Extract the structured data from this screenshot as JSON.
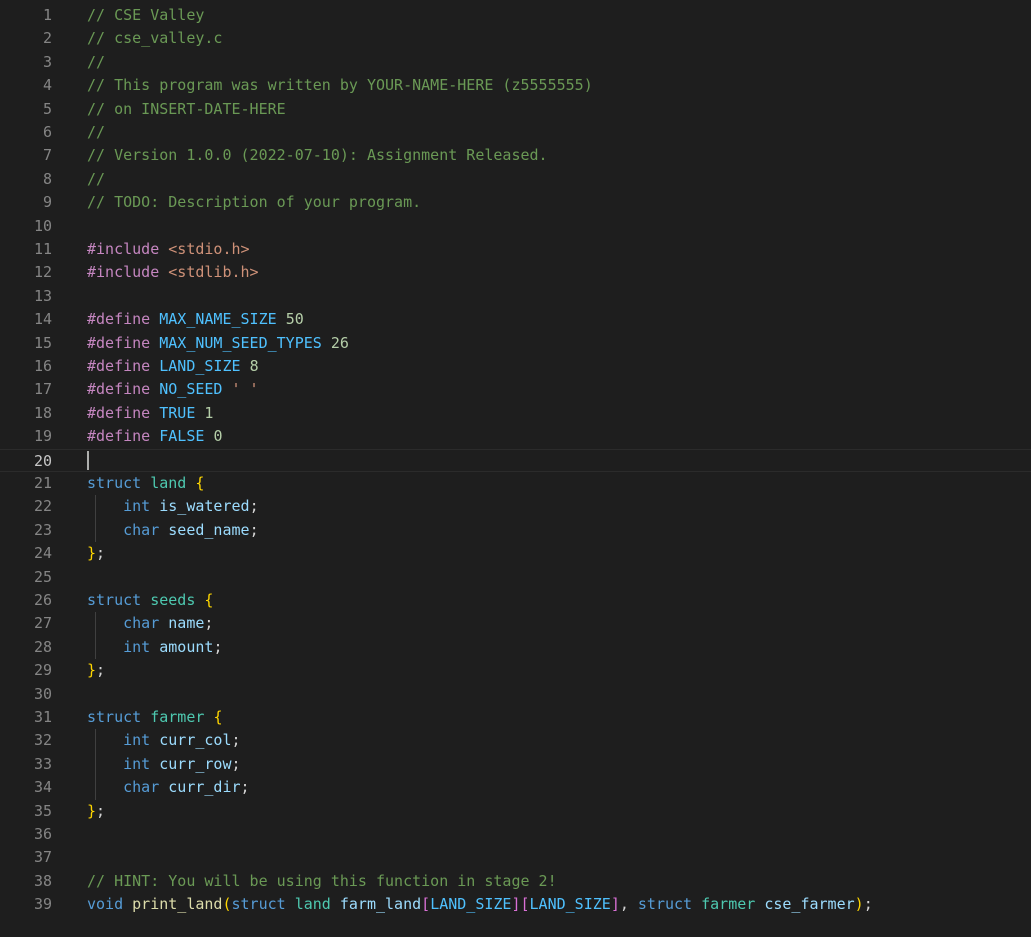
{
  "editor": {
    "language": "c",
    "current_line": 20,
    "colors": {
      "background": "#1e1e1e",
      "comment": "#6a9955",
      "keyword": "#569cd6",
      "macro": "#c586c0",
      "constant": "#4fc1ff",
      "number": "#b5cea8",
      "string": "#ce9178",
      "type": "#4ec9b0",
      "variable": "#9cdcfe",
      "bracket": "#ffd700"
    },
    "lines": [
      {
        "n": "1",
        "tokens": [
          {
            "c": "comment",
            "t": "// CSE Valley"
          }
        ]
      },
      {
        "n": "2",
        "tokens": [
          {
            "c": "comment",
            "t": "// cse_valley.c"
          }
        ]
      },
      {
        "n": "3",
        "tokens": [
          {
            "c": "comment",
            "t": "//"
          }
        ]
      },
      {
        "n": "4",
        "tokens": [
          {
            "c": "comment",
            "t": "// This program was written by YOUR-NAME-HERE (z5555555)"
          }
        ]
      },
      {
        "n": "5",
        "tokens": [
          {
            "c": "comment",
            "t": "// on INSERT-DATE-HERE"
          }
        ]
      },
      {
        "n": "6",
        "tokens": [
          {
            "c": "comment",
            "t": "//"
          }
        ]
      },
      {
        "n": "7",
        "tokens": [
          {
            "c": "comment",
            "t": "// Version 1.0.0 (2022-07-10): Assignment Released."
          }
        ]
      },
      {
        "n": "8",
        "tokens": [
          {
            "c": "comment",
            "t": "//"
          }
        ]
      },
      {
        "n": "9",
        "tokens": [
          {
            "c": "comment",
            "t": "// TODO: Description of your program."
          }
        ]
      },
      {
        "n": "10",
        "tokens": []
      },
      {
        "n": "11",
        "tokens": [
          {
            "c": "macro",
            "t": "#include "
          },
          {
            "c": "include-str",
            "t": "<stdio.h>"
          }
        ]
      },
      {
        "n": "12",
        "tokens": [
          {
            "c": "macro",
            "t": "#include "
          },
          {
            "c": "include-str",
            "t": "<stdlib.h>"
          }
        ]
      },
      {
        "n": "13",
        "tokens": []
      },
      {
        "n": "14",
        "tokens": [
          {
            "c": "macro",
            "t": "#define "
          },
          {
            "c": "ident",
            "t": "MAX_NAME_SIZE"
          },
          {
            "c": "text",
            "t": " "
          },
          {
            "c": "num",
            "t": "50"
          }
        ]
      },
      {
        "n": "15",
        "tokens": [
          {
            "c": "macro",
            "t": "#define "
          },
          {
            "c": "ident",
            "t": "MAX_NUM_SEED_TYPES"
          },
          {
            "c": "text",
            "t": " "
          },
          {
            "c": "num",
            "t": "26"
          }
        ]
      },
      {
        "n": "16",
        "tokens": [
          {
            "c": "macro",
            "t": "#define "
          },
          {
            "c": "ident",
            "t": "LAND_SIZE"
          },
          {
            "c": "text",
            "t": " "
          },
          {
            "c": "num",
            "t": "8"
          }
        ]
      },
      {
        "n": "17",
        "tokens": [
          {
            "c": "macro",
            "t": "#define "
          },
          {
            "c": "ident",
            "t": "NO_SEED"
          },
          {
            "c": "text",
            "t": " "
          },
          {
            "c": "str",
            "t": "' '"
          }
        ]
      },
      {
        "n": "18",
        "tokens": [
          {
            "c": "macro",
            "t": "#define "
          },
          {
            "c": "ident",
            "t": "TRUE"
          },
          {
            "c": "text",
            "t": " "
          },
          {
            "c": "num",
            "t": "1"
          }
        ]
      },
      {
        "n": "19",
        "tokens": [
          {
            "c": "macro",
            "t": "#define "
          },
          {
            "c": "ident",
            "t": "FALSE"
          },
          {
            "c": "text",
            "t": " "
          },
          {
            "c": "num",
            "t": "0"
          }
        ]
      },
      {
        "n": "20",
        "tokens": []
      },
      {
        "n": "21",
        "tokens": [
          {
            "c": "kw",
            "t": "struct"
          },
          {
            "c": "text",
            "t": " "
          },
          {
            "c": "type",
            "t": "land"
          },
          {
            "c": "text",
            "t": " "
          },
          {
            "c": "brace",
            "t": "{"
          }
        ]
      },
      {
        "n": "22",
        "tokens": [
          {
            "c": "text",
            "t": "    "
          },
          {
            "c": "kw",
            "t": "int"
          },
          {
            "c": "text",
            "t": " "
          },
          {
            "c": "var",
            "t": "is_watered"
          },
          {
            "c": "text",
            "t": ";"
          }
        ]
      },
      {
        "n": "23",
        "tokens": [
          {
            "c": "text",
            "t": "    "
          },
          {
            "c": "kw",
            "t": "char"
          },
          {
            "c": "text",
            "t": " "
          },
          {
            "c": "var",
            "t": "seed_name"
          },
          {
            "c": "text",
            "t": ";"
          }
        ]
      },
      {
        "n": "24",
        "tokens": [
          {
            "c": "brace",
            "t": "}"
          },
          {
            "c": "text",
            "t": ";"
          }
        ]
      },
      {
        "n": "25",
        "tokens": []
      },
      {
        "n": "26",
        "tokens": [
          {
            "c": "kw",
            "t": "struct"
          },
          {
            "c": "text",
            "t": " "
          },
          {
            "c": "type",
            "t": "seeds"
          },
          {
            "c": "text",
            "t": " "
          },
          {
            "c": "brace",
            "t": "{"
          }
        ]
      },
      {
        "n": "27",
        "tokens": [
          {
            "c": "text",
            "t": "    "
          },
          {
            "c": "kw",
            "t": "char"
          },
          {
            "c": "text",
            "t": " "
          },
          {
            "c": "var",
            "t": "name"
          },
          {
            "c": "text",
            "t": ";"
          }
        ]
      },
      {
        "n": "28",
        "tokens": [
          {
            "c": "text",
            "t": "    "
          },
          {
            "c": "kw",
            "t": "int"
          },
          {
            "c": "text",
            "t": " "
          },
          {
            "c": "var",
            "t": "amount"
          },
          {
            "c": "text",
            "t": ";"
          }
        ]
      },
      {
        "n": "29",
        "tokens": [
          {
            "c": "brace",
            "t": "}"
          },
          {
            "c": "text",
            "t": ";"
          }
        ]
      },
      {
        "n": "30",
        "tokens": []
      },
      {
        "n": "31",
        "tokens": [
          {
            "c": "kw",
            "t": "struct"
          },
          {
            "c": "text",
            "t": " "
          },
          {
            "c": "type",
            "t": "farmer"
          },
          {
            "c": "text",
            "t": " "
          },
          {
            "c": "brace",
            "t": "{"
          }
        ]
      },
      {
        "n": "32",
        "tokens": [
          {
            "c": "text",
            "t": "    "
          },
          {
            "c": "kw",
            "t": "int"
          },
          {
            "c": "text",
            "t": " "
          },
          {
            "c": "var",
            "t": "curr_col"
          },
          {
            "c": "text",
            "t": ";"
          }
        ]
      },
      {
        "n": "33",
        "tokens": [
          {
            "c": "text",
            "t": "    "
          },
          {
            "c": "kw",
            "t": "int"
          },
          {
            "c": "text",
            "t": " "
          },
          {
            "c": "var",
            "t": "curr_row"
          },
          {
            "c": "text",
            "t": ";"
          }
        ]
      },
      {
        "n": "34",
        "tokens": [
          {
            "c": "text",
            "t": "    "
          },
          {
            "c": "kw",
            "t": "char"
          },
          {
            "c": "text",
            "t": " "
          },
          {
            "c": "var",
            "t": "curr_dir"
          },
          {
            "c": "text",
            "t": ";"
          }
        ]
      },
      {
        "n": "35",
        "tokens": [
          {
            "c": "brace",
            "t": "}"
          },
          {
            "c": "text",
            "t": ";"
          }
        ]
      },
      {
        "n": "36",
        "tokens": []
      },
      {
        "n": "37",
        "tokens": []
      },
      {
        "n": "38",
        "tokens": [
          {
            "c": "comment",
            "t": "// HINT: You will be using this function in stage 2!"
          }
        ]
      },
      {
        "n": "39",
        "tokens": [
          {
            "c": "kw",
            "t": "void"
          },
          {
            "c": "text",
            "t": " "
          },
          {
            "c": "func",
            "t": "print_land"
          },
          {
            "c": "brace",
            "t": "("
          },
          {
            "c": "kw",
            "t": "struct"
          },
          {
            "c": "text",
            "t": " "
          },
          {
            "c": "type",
            "t": "land"
          },
          {
            "c": "text",
            "t": " "
          },
          {
            "c": "var",
            "t": "farm_land"
          },
          {
            "c": "paren",
            "t": "["
          },
          {
            "c": "ident",
            "t": "LAND_SIZE"
          },
          {
            "c": "paren",
            "t": "]["
          },
          {
            "c": "ident",
            "t": "LAND_SIZE"
          },
          {
            "c": "paren",
            "t": "]"
          },
          {
            "c": "text",
            "t": ", "
          },
          {
            "c": "kw",
            "t": "struct"
          },
          {
            "c": "text",
            "t": " "
          },
          {
            "c": "type",
            "t": "farmer"
          },
          {
            "c": "text",
            "t": " "
          },
          {
            "c": "var",
            "t": "cse_farmer"
          },
          {
            "c": "brace",
            "t": ")"
          },
          {
            "c": "text",
            "t": ";"
          }
        ]
      }
    ]
  }
}
